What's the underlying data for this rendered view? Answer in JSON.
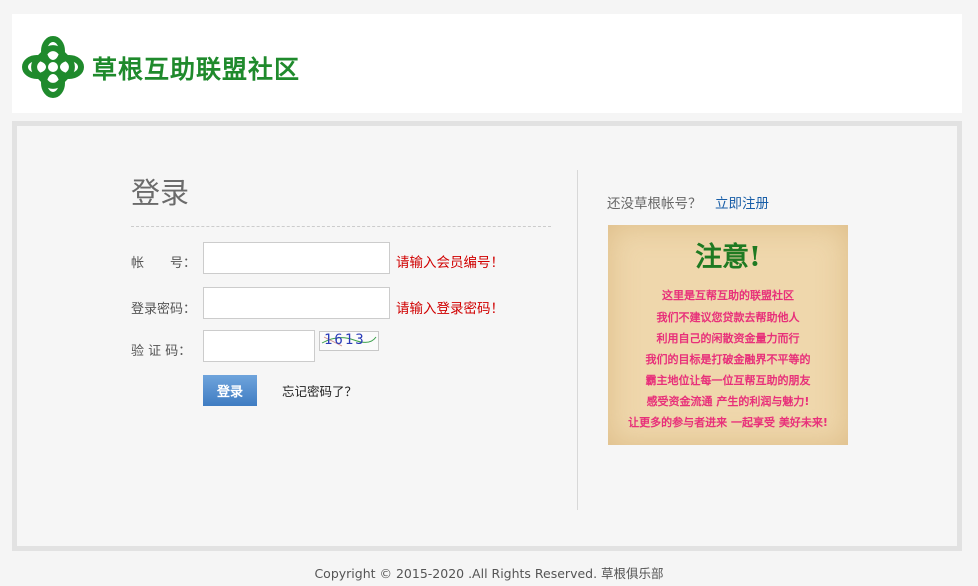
{
  "header": {
    "logo_text": "草根互助联盟社区"
  },
  "login": {
    "title": "登录",
    "account_label": "帐　　号：",
    "account_value": "",
    "account_hint": "请输入会员编号！",
    "password_label": "登录密码：",
    "password_value": "",
    "password_hint": "请输入登录密码！",
    "captcha_label": "验 证 码：",
    "captcha_value": "",
    "captcha_code": "1613",
    "submit_label": "登录",
    "forgot_label": "忘记密码了？"
  },
  "register": {
    "prompt": "还没草根帐号？",
    "link_label": "立即注册"
  },
  "notice": {
    "title": "注意!",
    "lines": [
      "这里是互帮互助的联盟社区",
      "我们不建议您贷款去帮助他人",
      "利用自己的闲散资金量力而行",
      "我们的目标是打破金融界不平等的",
      "霸主地位让每一位互帮互助的朋友",
      "感受资金流通  产生的利润与魅力!",
      "让更多的参与者进来  一起享受  美好未来!"
    ]
  },
  "footer": {
    "copyright": "Copyright © 2015-2020 .All Rights Reserved. 草根俱乐部"
  },
  "colors": {
    "brand_green": "#1f8a2c",
    "hint_red": "#d00000",
    "link_blue": "#1a5fa8",
    "notice_pink": "#e8307a",
    "button_blue": "#4a88c8"
  }
}
